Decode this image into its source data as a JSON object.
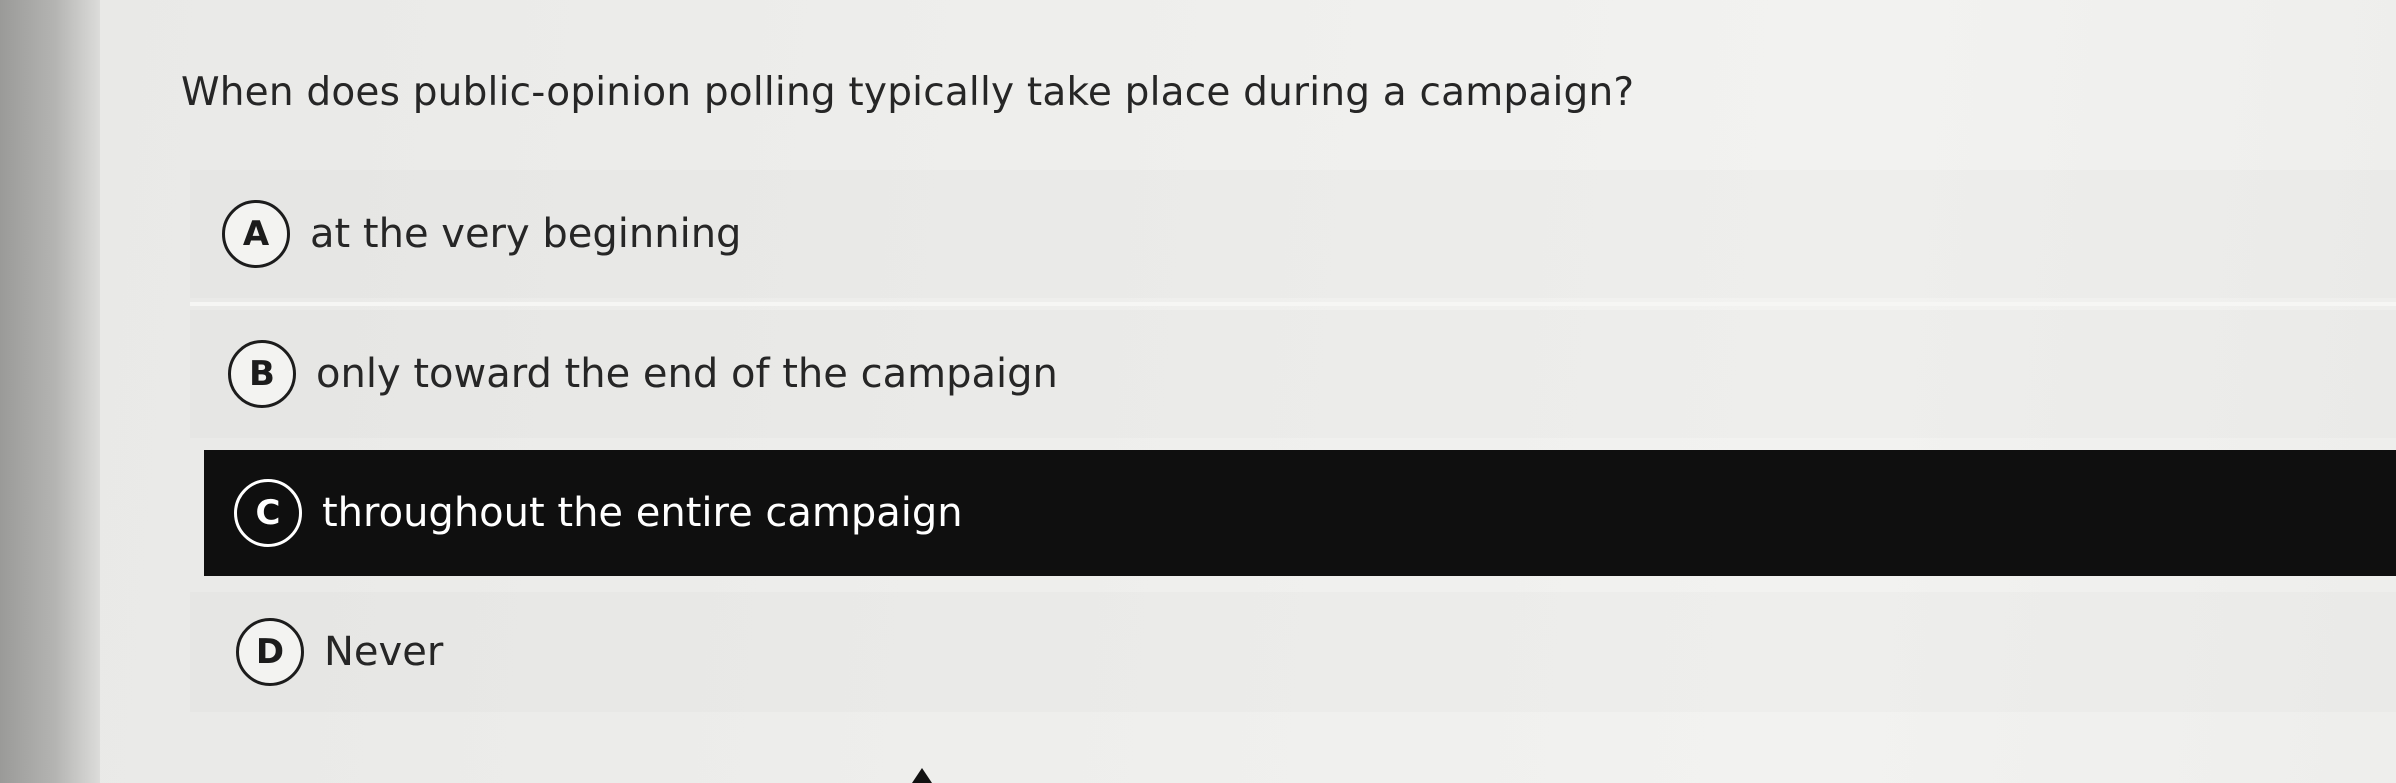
{
  "quiz": {
    "question": "When does public-opinion polling typically take place during a campaign?",
    "selected_option": "C",
    "options": [
      {
        "letter": "A",
        "text": "at the very beginning"
      },
      {
        "letter": "B",
        "text": "only toward the end of the campaign"
      },
      {
        "letter": "C",
        "text": "throughout the entire campaign"
      },
      {
        "letter": "D",
        "text": "Never"
      }
    ]
  },
  "colors": {
    "selected_background": "#0f0f0f",
    "selected_text": "#ffffff",
    "text": "#262626",
    "page_background": "#eeeeec"
  }
}
